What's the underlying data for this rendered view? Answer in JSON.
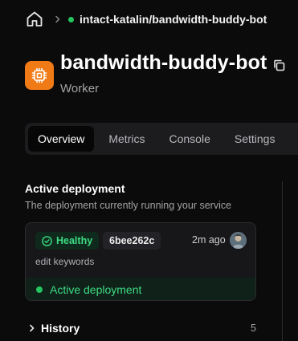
{
  "breadcrumb": {
    "home_icon": "home-icon",
    "separator_icon": "chevron-right-icon",
    "project_path": "intact-katalin/bandwidth-buddy-bot",
    "status_color": "#22c55e"
  },
  "service": {
    "icon": "cpu-chip-icon",
    "icon_bg": "#f07a16",
    "name": "bandwidth-buddy-bot",
    "type": "Worker",
    "copy_icon": "copy-icon"
  },
  "tabs": [
    {
      "label": "Overview",
      "active": true
    },
    {
      "label": "Metrics",
      "active": false
    },
    {
      "label": "Console",
      "active": false
    },
    {
      "label": "Settings",
      "active": false
    }
  ],
  "active_deployment": {
    "title": "Active deployment",
    "subtitle": "The deployment currently running your service",
    "status_label": "Healthy",
    "status_icon": "check-circle-icon",
    "commit_hash": "6bee262c",
    "time_ago": "2m ago",
    "avatar": "user-avatar",
    "commit_message": "edit keywords",
    "footer_label": "Active deployment",
    "accent_color": "#3ddc84"
  },
  "history": {
    "label": "History",
    "count": "5",
    "icon": "chevron-right-icon"
  }
}
